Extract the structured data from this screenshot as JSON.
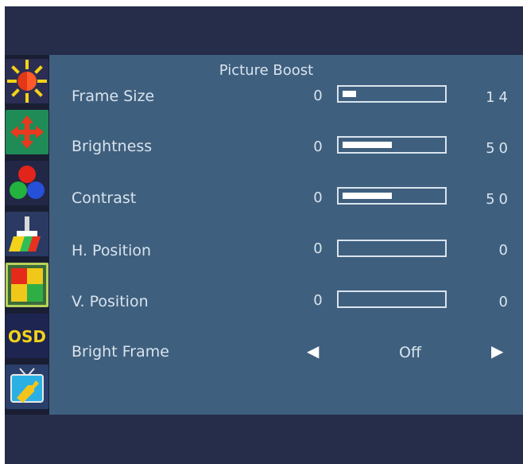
{
  "title": "Picture Boost",
  "icons": [
    {
      "name": "brightness-icon"
    },
    {
      "name": "position-icon"
    },
    {
      "name": "color-icon"
    },
    {
      "name": "paint-icon"
    },
    {
      "name": "picture-boost-icon",
      "selected": true
    },
    {
      "name": "osd-icon",
      "text": "OSD"
    },
    {
      "name": "tv-settings-icon"
    }
  ],
  "rows": [
    {
      "label": "Frame Size",
      "min": "0",
      "value": "14",
      "fill_percent": 14
    },
    {
      "label": "Brightness",
      "min": "0",
      "value": "50",
      "fill_percent": 50
    },
    {
      "label": "Contrast",
      "min": "0",
      "value": "50",
      "fill_percent": 50
    },
    {
      "label": "H. Position",
      "min": "0",
      "value": "0",
      "fill_percent": 0
    },
    {
      "label": "V. Position",
      "min": "0",
      "value": "0",
      "fill_percent": 0
    }
  ],
  "bright_frame": {
    "label": "Bright Frame",
    "value": "Off",
    "left_arrow": "◀",
    "right_arrow": "▶"
  },
  "colors": {
    "panel": "#3f5f7e",
    "frame": "#252d4a",
    "text": "#d8e4ee",
    "selected_outline": "#b8d25a"
  }
}
